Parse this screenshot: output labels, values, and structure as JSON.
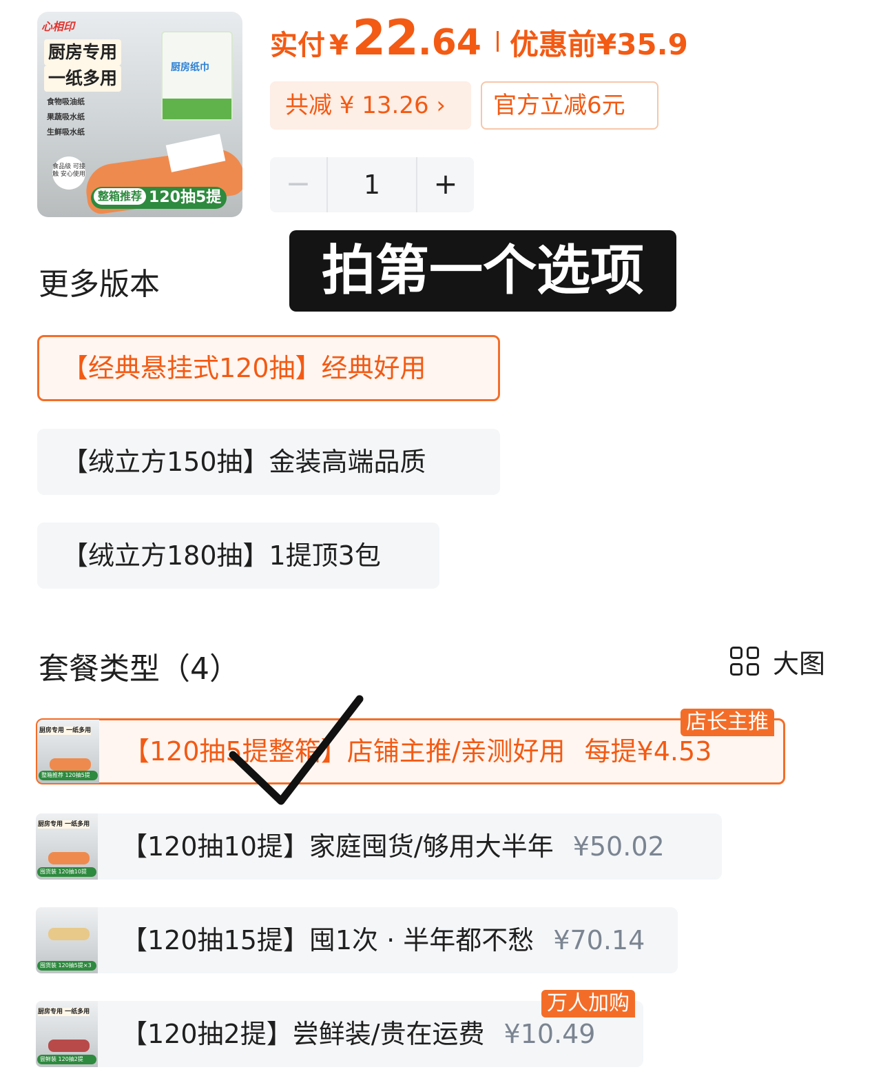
{
  "product": {
    "thumbnail": {
      "brand": "心相印",
      "headline_1": "厨房专用",
      "headline_2": "一纸多用",
      "features": [
        "食物吸油纸",
        "果蔬吸水纸",
        "生鲜吸水纸"
      ],
      "food_safe": "食品级 可接触 安心使用",
      "pack_label": "厨房纸巾",
      "badge_tag": "整箱推荐",
      "badge_text": "120抽5提"
    }
  },
  "price": {
    "pay_label": "实付",
    "currency": "¥",
    "amount_int": "22",
    "amount_dec": ".64",
    "before_label": "优惠前",
    "before_amount": "¥35.9",
    "total_discount": "共减 ¥ 13.26 ›",
    "official_discount": "官方立减6元"
  },
  "stepper": {
    "minus": "−",
    "quantity": "1",
    "plus": "+"
  },
  "overlay_banner": "拍第一个选项",
  "versions": {
    "title": "更多版本",
    "options": [
      {
        "label": "【经典悬挂式120抽】经典好用",
        "selected": true
      },
      {
        "label": "【绒立方150抽】金装高端品质",
        "selected": false
      },
      {
        "label": "【绒立方180抽】1提顶3包",
        "selected": false
      }
    ]
  },
  "packages": {
    "title": "套餐类型（4）",
    "big_view_label": "大图",
    "items": [
      {
        "name": "【120抽5提整箱】店铺主推/亲测好用",
        "price": "每提¥4.53",
        "ribbon": "店长主推",
        "img_badge": "整箱推荐 120抽5提",
        "img_title": "厨房专用 一纸多用",
        "selected": true
      },
      {
        "name": "【120抽10提】家庭囤货/够用大半年",
        "price": "¥50.02",
        "ribbon": "",
        "img_badge": "囤货装 120抽10提",
        "img_title": "厨房专用 一纸多用",
        "selected": false
      },
      {
        "name": "【120抽15提】囤1次 · 半年都不愁",
        "price": "¥70.14",
        "ribbon": "",
        "img_badge": "囤货装 120抽5提×3",
        "img_title": "",
        "selected": false
      },
      {
        "name": "【120抽2提】尝鲜装/贵在运费",
        "price": "¥10.49",
        "ribbon": "万人加购",
        "img_badge": "尝鲜装 120抽2提",
        "img_title": "厨房专用 一纸多用",
        "selected": false
      }
    ]
  },
  "colors": {
    "accent": "#f35a13",
    "accent_border": "#f36d28",
    "muted_price": "#7b8491",
    "chip_bg": "#f4f6f8",
    "badge_green": "#2d8a3e"
  }
}
